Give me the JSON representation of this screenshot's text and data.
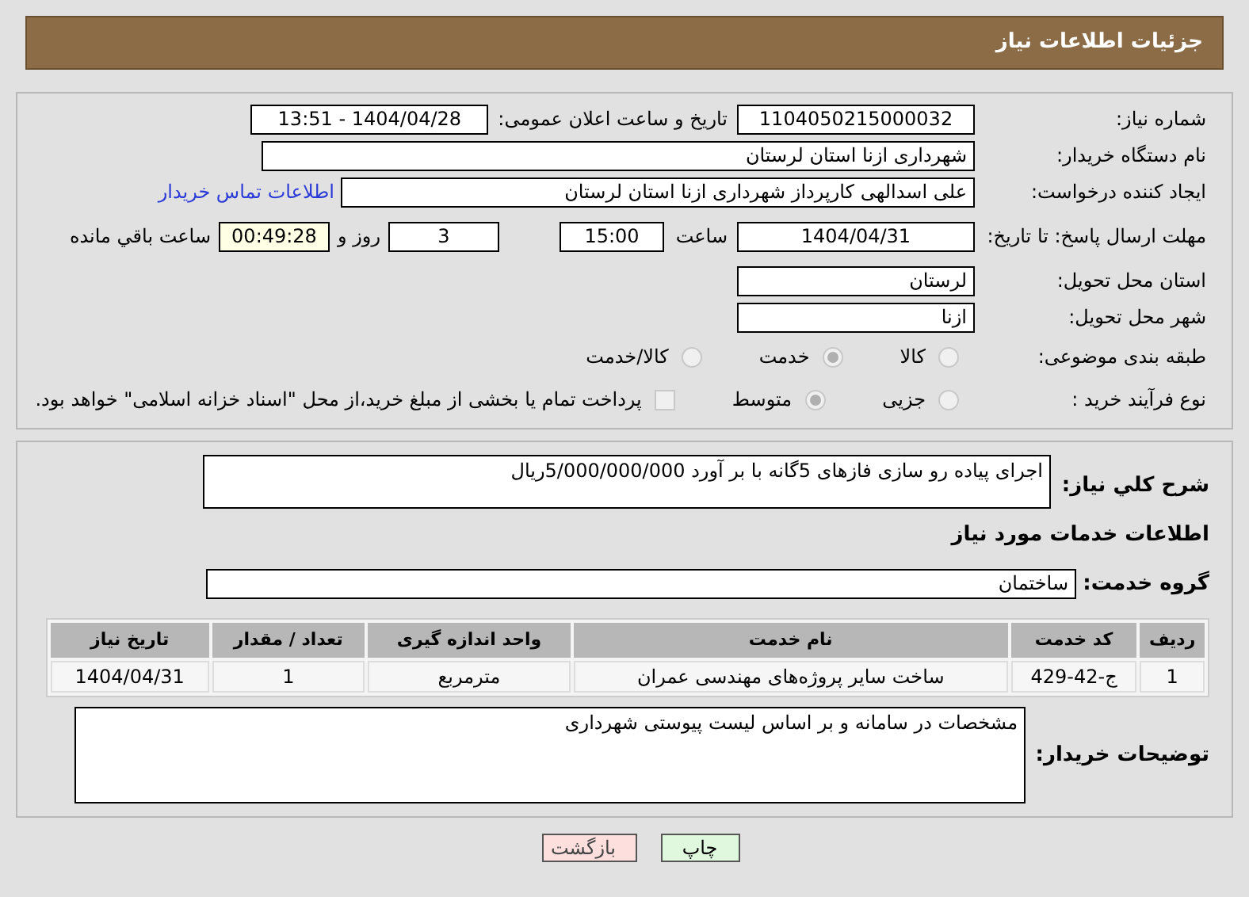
{
  "header": {
    "title": "جزئیات اطلاعات نیاز"
  },
  "details": {
    "need_number": {
      "label": "شماره نیاز:",
      "value": "1104050215000032"
    },
    "announce": {
      "label": "تاریخ و ساعت اعلان عمومی:",
      "value": "1404/04/28 - 13:51"
    },
    "buyer": {
      "label": "نام دستگاه خریدار:",
      "value": "شهرداری ازنا استان لرستان"
    },
    "creator": {
      "label": "ایجاد کننده درخواست:",
      "value": "علی اسدالهی کارپرداز شهرداری ازنا استان لرستان",
      "link": "اطلاعات تماس خریدار"
    },
    "deadline": {
      "label": "مهلت ارسال پاسخ: تا تاریخ:",
      "date": "1404/04/31",
      "time_label": "ساعت",
      "time": "15:00",
      "days": "3",
      "days_label": "روز و",
      "remaining": "00:49:28",
      "remaining_label": "ساعت باقي مانده"
    },
    "province": {
      "label": "استان محل تحویل:",
      "value": "لرستان"
    },
    "city": {
      "label": "شهر محل تحویل:",
      "value": "ازنا"
    },
    "category": {
      "label": "طبقه بندی موضوعی:",
      "options": [
        {
          "label": "کالا",
          "selected": false
        },
        {
          "label": "خدمت",
          "selected": true
        },
        {
          "label": "کالا/خدمت",
          "selected": false
        }
      ]
    },
    "process": {
      "label": "نوع فرآیند خرید :",
      "options": [
        {
          "label": "جزیی",
          "selected": false
        },
        {
          "label": "متوسط",
          "selected": true
        }
      ],
      "treasury": {
        "label": "پرداخت تمام یا بخشی از مبلغ خرید،از محل \"اسناد خزانه اسلامی\" خواهد بود.",
        "checked": false
      }
    }
  },
  "need": {
    "label": "شرح کلي نياز:",
    "value": "اجرای پیاده رو سازی فازهای 5گانه با بر آورد 5/000/000/000ریال",
    "services_title": "اطلاعات خدمات مورد نیاز",
    "group_label": "گروه خدمت:",
    "group": "ساختمان"
  },
  "table": {
    "columns": [
      "ردیف",
      "کد خدمت",
      "نام خدمت",
      "واحد اندازه گیری",
      "تعداد / مقدار",
      "تاریخ نیاز"
    ],
    "rows": [
      [
        "1",
        "ج-42-429",
        "ساخت سایر پروژه‌های مهندسی عمران",
        "مترمربع",
        "1",
        "1404/04/31"
      ]
    ]
  },
  "notes": {
    "label": "توضیحات خریدار:",
    "value": "مشخصات در سامانه و بر اساس لیست پیوستی شهرداری"
  },
  "buttons": [
    {
      "label": "چاپ",
      "kind": "print"
    },
    {
      "label": "بازگشت",
      "kind": "back"
    }
  ]
}
